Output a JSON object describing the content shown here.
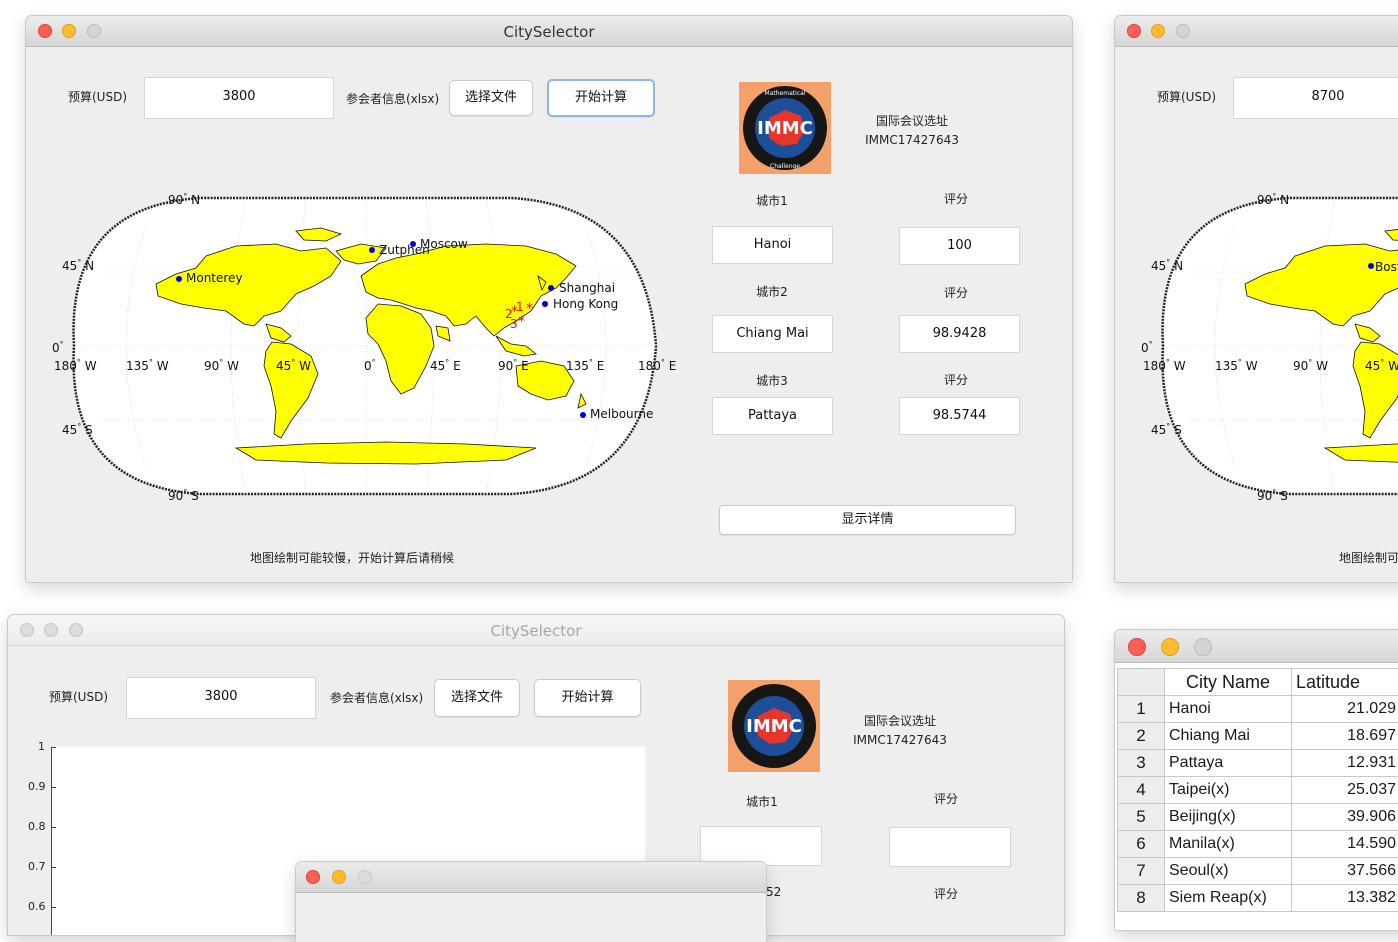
{
  "app_title": "CitySelector",
  "labels": {
    "budget": "预算(USD)",
    "participants": "参会者信息(xlsx)",
    "choose_file": "选择文件",
    "start": "开始计算",
    "conference": "国际会议选址",
    "team_id": "IMMC17427643",
    "city1": "城市1",
    "city2": "城市2",
    "city3": "城市3",
    "score": "评分",
    "details": "显示详情",
    "map_note": "地图绘制可能较慢，开始计算后请稍候",
    "map_note_partial": "地图绘制可"
  },
  "main_window": {
    "budget_value": "3800",
    "results": [
      {
        "city": "Hanoi",
        "score": "100"
      },
      {
        "city": "Chiang Mai",
        "score": "98.9428"
      },
      {
        "city": "Pattaya",
        "score": "98.5744"
      }
    ]
  },
  "right_window": {
    "budget_value": "8700"
  },
  "bottom_window": {
    "budget_value": "3800",
    "y_ticks": [
      "1",
      "0.9",
      "0.8",
      "0.7",
      "0.6"
    ],
    "partial_city_label": "52"
  },
  "map": {
    "lat_labels": [
      "90",
      "45",
      "0",
      "45",
      "90"
    ],
    "lat_dirs": [
      "N",
      "N",
      "",
      "S",
      "S"
    ],
    "lon_labels": [
      "180",
      "135",
      "90",
      "45",
      "0",
      "45",
      "90",
      "135",
      "180"
    ],
    "lon_dirs": [
      "W",
      "W",
      "W",
      "W",
      "",
      "E",
      "E",
      "E",
      "E"
    ],
    "cities": [
      "Monterey",
      "Zutphen",
      "Moscow",
      "Shanghai",
      "Hong Kong",
      "Melbourne",
      "Boston"
    ],
    "markers": [
      "1",
      "2",
      "3"
    ],
    "land_color": "#ffff00",
    "ocean_color": "#ffffff",
    "city_dot_color": "#0000cc",
    "marker_color": "#ff0000"
  },
  "table": {
    "headers": [
      "City Name",
      "Latitude"
    ],
    "rows": [
      {
        "num": "1",
        "name": "Hanoi",
        "lat": "21.029"
      },
      {
        "num": "2",
        "name": "Chiang Mai",
        "lat": "18.697"
      },
      {
        "num": "3",
        "name": "Pattaya",
        "lat": "12.931"
      },
      {
        "num": "4",
        "name": "Taipei(x)",
        "lat": "25.037"
      },
      {
        "num": "5",
        "name": "Beijing(x)",
        "lat": "39.906"
      },
      {
        "num": "6",
        "name": "Manila(x)",
        "lat": "14.590"
      },
      {
        "num": "7",
        "name": "Seoul(x)",
        "lat": "37.566"
      },
      {
        "num": "8",
        "name": "Siem Reap(x)",
        "lat": "13.382"
      }
    ]
  },
  "logo": {
    "ring_text": "International Mathematical Modeling Challenge",
    "initials": "IMMC"
  }
}
